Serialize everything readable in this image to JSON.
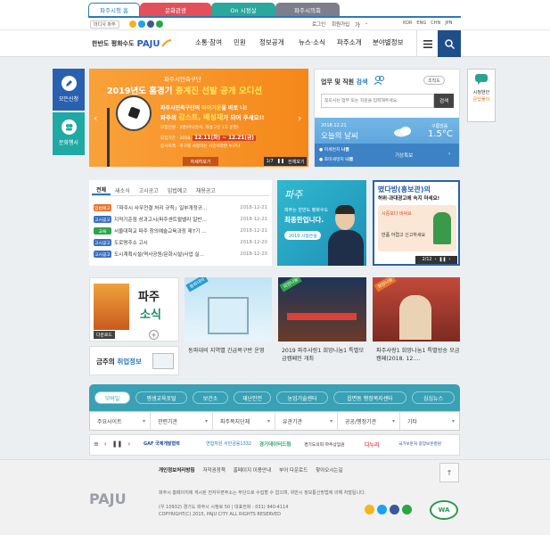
{
  "top_tabs": [
    {
      "label": "파주시청 홈",
      "color": "#ffffff",
      "fg": "#2a7ab8"
    },
    {
      "label": "문화관광",
      "color": "#e3505a",
      "fg": "#ffffff"
    },
    {
      "label": "On 시정살",
      "color": "#29a89b",
      "fg": "#ffffff"
    },
    {
      "label": "파주시의회",
      "color": "#7d7d8c",
      "fg": "#ffffff"
    }
  ],
  "util": {
    "talk": "마디사 파주",
    "login": "로그인",
    "join": "회원가입",
    "font_plus": "가",
    "font_minus": "-",
    "langs": [
      "KOR",
      "ENG",
      "CHN",
      "JPN"
    ]
  },
  "brand": {
    "slogan": "한반도 평화수도",
    "logo": "PAJU"
  },
  "gnb": [
    "소통·참여",
    "민원",
    "정보공개",
    "뉴스·소식",
    "파주소개",
    "분야별정보"
  ],
  "quick_left": [
    {
      "label": "모든신청",
      "icon": "pencil-icon",
      "color": "#2a60b0"
    },
    {
      "label": "문화행사",
      "icon": "people-icon",
      "color": "#1fa9a4"
    }
  ],
  "banner": {
    "small": "파주시민축구단",
    "title_a": "2019년도 홈경기 ",
    "title_b": "중계진 선발 공개 오디션",
    "body_1": "파주시민축구단의 ",
    "body_1b": "마이기운",
    "body_1c": "을 바로 나!",
    "body_2": "파주의 ",
    "body_2b": "감스트, 배성재",
    "body_2c": "가 되어 주세요!!",
    "info_1": "모집인원 - 2명(아나운서, 해설 2인 1조 운영)",
    "info_2": "모집기간 - 2018. ",
    "info_2b": "12.11(화) ~ 12.21(금)",
    "info_3": "응시자격 - 축구를 사랑하는 시민이라면 누구나",
    "more": "자세히보기",
    "pager": "1/7",
    "all": "전체보기"
  },
  "search": {
    "title": "업무 및 직원 ",
    "title_b": "검색",
    "org": "조직도",
    "placeholder": "찾으시는 업무 또는 직원을 입력해주세요.",
    "button": "검색"
  },
  "weather": {
    "date": "2018.12.21",
    "headline": "오늘의 날씨",
    "location": "구름많음",
    "temp": "1.5°C",
    "dust": "미세먼지",
    "dust_val": "나쁨",
    "fine_dust": "초미세먼지",
    "fine_val": "나쁨",
    "forecast": "기상특보"
  },
  "quick_right": {
    "label_a": "시청현안",
    "label_b": "문답풀이"
  },
  "notice": {
    "tabs": [
      "전체",
      "새소식",
      "고시공고",
      "입법예고",
      "채용공고"
    ],
    "items": [
      {
        "badge": "입법예고",
        "color": "#e8742b",
        "text": "「파주시 사무전결 처리 규칙」일부개정규…",
        "date": "2018-12-21"
      },
      {
        "badge": "고시공고",
        "color": "#3a6fc0",
        "text": "지적기준점 성과고시(파주센트럴밸리 일반…",
        "date": "2018-12-21"
      },
      {
        "badge": "교육",
        "color": "#2fa44a",
        "text": "서울대학교 파주 창의예술교육과정 제7기 …",
        "date": "2018-12-21"
      },
      {
        "badge": "고시공고",
        "color": "#3a6fc0",
        "text": "도로명주소 고시",
        "date": "2018-12-20"
      },
      {
        "badge": "고시공고",
        "color": "#3a6fc0",
        "text": "도시계획시설(역사공원/문화시설)사업 실…",
        "date": "2018-12-20"
      }
    ]
  },
  "mayor_card": {
    "tag": "파주",
    "line1": "파주는 한반도 평화수도",
    "line2": "최종한입니다.",
    "btn": "2019 시정연설"
  },
  "promo_card": {
    "line1": "떴다방(홍보관)의",
    "line2": "허위·과대광고에 속지 마세요!",
    "line3": "시중보다 비싸요",
    "line4": "반품 어렵고 신고하세요",
    "pager": "2/12"
  },
  "sosik": {
    "title": "파주",
    "title2": "소식",
    "download": "다운로드"
  },
  "job": {
    "text_a": "금주의 ",
    "text_b": "취업정보"
  },
  "news": [
    {
      "tag": "동파대비",
      "caption": "동파대비 지역별 긴급복구반 운영"
    },
    {
      "tag": "희망나눔",
      "caption": "2019 파주사랑1 희망나눔1 특별모금캠페인 개최"
    },
    {
      "tag": "희망나눔",
      "caption": "파주사랑1 희망나눔1 특별방송 모금캠페(2018. 12.…"
    }
  ],
  "categories": [
    "모바일",
    "평생교육포털",
    "보건소",
    "재난안전",
    "농업기술센터",
    "읍면동 행정복지센터",
    "심심뉴스"
  ],
  "selects": [
    "주요사이트",
    "관련기관",
    "파주복지단체",
    "유관기관",
    "공공/행정기관",
    "기타"
  ],
  "partners": [
    "GAF 국제개발협력",
    "연합자원 서민금융1332",
    "경기데이터드림",
    "경기도의회 파주상임원",
    "다누리",
    "국가보훈처 중앙보훈병원"
  ],
  "footer": {
    "links": [
      "개인정보처리방침",
      "저작권정책",
      "홈페이지 이용안내",
      "부어 다운로드",
      "찾아오시는길"
    ],
    "notice": "파주시 홈페이지에 게시된 전자우편주소는 무단으로 수집할 수 없으며, 위반시 정보통신망법에 의해 처벌됩니다.",
    "address": "(우 10932) 경기도 파주시 시청로 50 | 대표전화 : 031) 940-4114",
    "copyright": "COPYRIGHT(C) 2015, PAJU CITY ALL RIGHTS RESERVED",
    "logo": "PAJU",
    "wa_badge": "WA"
  }
}
